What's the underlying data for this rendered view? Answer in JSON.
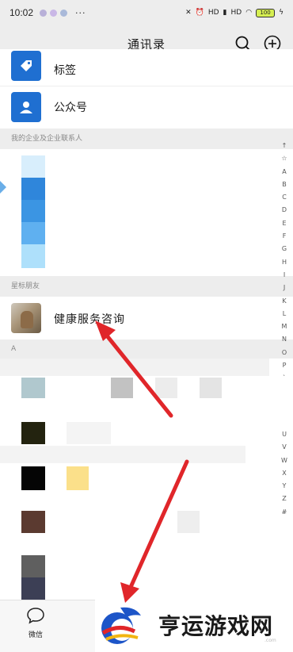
{
  "status_bar": {
    "time": "10:02",
    "more": "···",
    "signal1": "HD",
    "signal2": "HD",
    "battery": "100"
  },
  "header": {
    "title": "通讯录",
    "icons": {
      "search": "search-icon",
      "add": "add-circle-icon"
    }
  },
  "function_rows": [
    {
      "label": "标签",
      "icon": "tag-icon"
    },
    {
      "label": "公众号",
      "icon": "person-card-icon"
    }
  ],
  "sections": {
    "enterprise": "我的企业及企业联系人",
    "starred": "星标朋友",
    "a": "A"
  },
  "starred_contact": {
    "name": "健康服务咨询"
  },
  "index_bar": [
    "↑",
    "☆",
    "A",
    "B",
    "C",
    "D",
    "E",
    "F",
    "G",
    "H",
    "I",
    "J",
    "K",
    "L",
    "M",
    "N",
    "O",
    "P",
    "`"
  ],
  "index_bar_tail": [
    "U",
    "V",
    "W",
    "X",
    "Y",
    "Z",
    "#"
  ],
  "tabbar": {
    "chat_label": "微信"
  },
  "watermark": {
    "text": "亨运游戏网",
    "url": ".com"
  },
  "colors": {
    "accent": "#1f6fd1",
    "arrow": "#e0262a",
    "background": "#ededed"
  }
}
